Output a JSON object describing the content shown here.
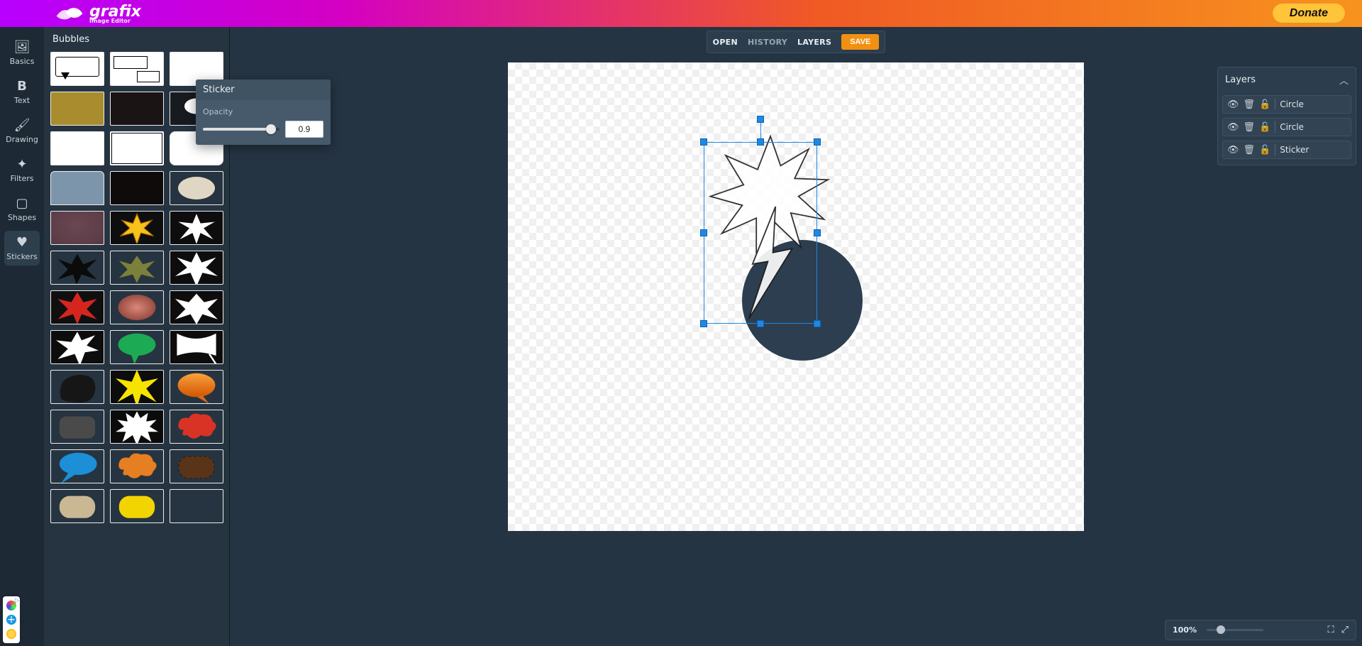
{
  "header": {
    "brand": "grafix",
    "brand_sub": "Image Editor",
    "donate_label": "Donate"
  },
  "toolstrip": [
    {
      "id": "basics",
      "label": "Basics",
      "icon": "image-icon",
      "active": false
    },
    {
      "id": "text",
      "label": "Text",
      "icon": "bold-icon",
      "active": false
    },
    {
      "id": "drawing",
      "label": "Drawing",
      "icon": "brush-icon",
      "active": false
    },
    {
      "id": "filters",
      "label": "Filters",
      "icon": "sparkle-icon",
      "active": false
    },
    {
      "id": "shapes",
      "label": "Shapes",
      "icon": "rect-icon",
      "active": false
    },
    {
      "id": "stickers",
      "label": "Stickers",
      "icon": "heart-icon",
      "active": true
    }
  ],
  "sticker_panel": {
    "title": "Bubbles"
  },
  "popup": {
    "title": "Sticker",
    "opacity_label": "Opacity",
    "opacity_value": "0.9"
  },
  "top_actions": {
    "open": "OPEN",
    "history": "HISTORY",
    "layers": "LAYERS",
    "save": "SAVE"
  },
  "layers_panel": {
    "title": "Layers",
    "items": [
      {
        "name": "Circle"
      },
      {
        "name": "Circle"
      },
      {
        "name": "Sticker"
      }
    ]
  },
  "zoom": {
    "label": "100%"
  }
}
